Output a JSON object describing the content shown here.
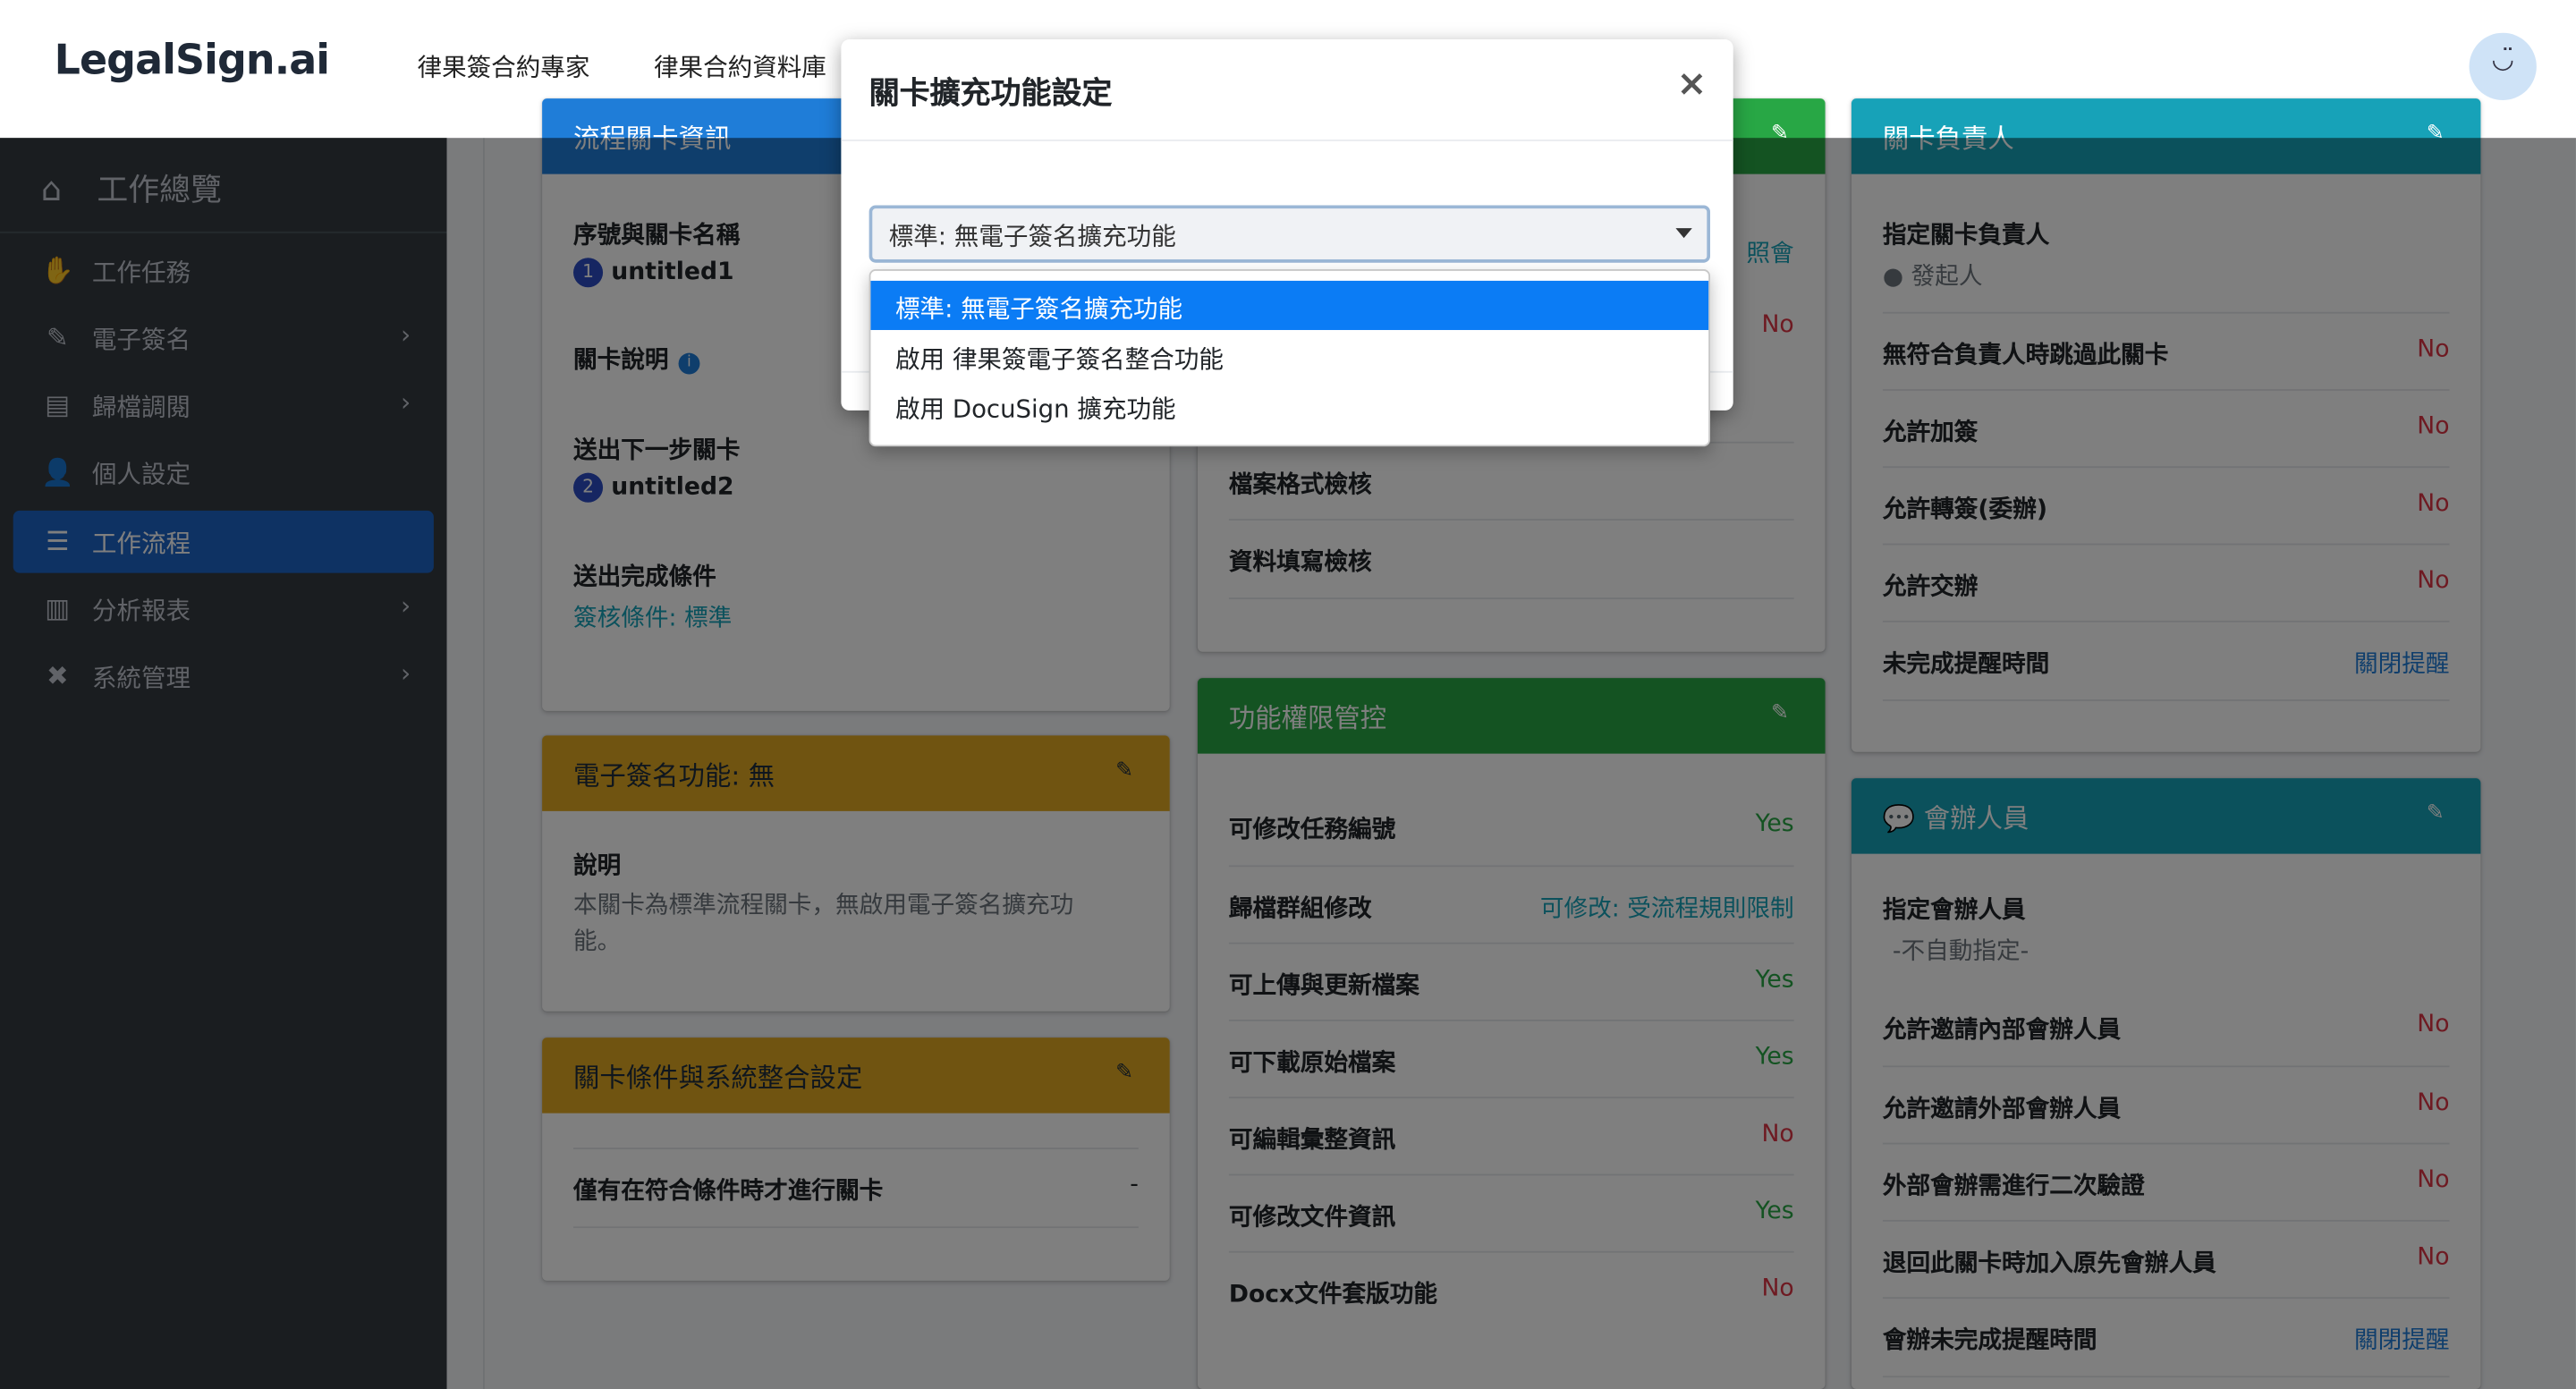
{
  "brand": "LegalSign.ai",
  "topnav": [
    "律果簽合約專家",
    "律果合約資料庫"
  ],
  "sidebar": {
    "dashboard": "工作總覽",
    "items": [
      {
        "label": "工作任務",
        "icon": "handshake-icon",
        "chevron": false
      },
      {
        "label": "電子簽名",
        "icon": "signature-icon",
        "chevron": true
      },
      {
        "label": "歸檔調閱",
        "icon": "archive-icon",
        "chevron": true
      },
      {
        "label": "個人設定",
        "icon": "user-cog-icon",
        "chevron": false
      },
      {
        "label": "工作流程",
        "icon": "tasks-icon",
        "chevron": false,
        "active": true
      },
      {
        "label": "分析報表",
        "icon": "chart-icon",
        "chevron": true
      },
      {
        "label": "系統管理",
        "icon": "tools-icon",
        "chevron": true
      }
    ]
  },
  "card_stage_info": {
    "title": "流程關卡資訊",
    "seq_label": "序號與關卡名稱",
    "seq_num": "1",
    "seq_name": "untitled1",
    "desc_label": "關卡說明",
    "next_label": "送出下一步關卡",
    "next_num": "2",
    "next_name": "untitled2",
    "cond_label": "送出完成條件",
    "cond_value": "簽核條件: 標準"
  },
  "card_esign": {
    "title": "電子簽名功能: 無",
    "desc_label": "說明",
    "desc_text": "本關卡為標準流程關卡，無啟用電子簽名擴充功能。"
  },
  "card_conditions": {
    "title": "關卡條件與系統整合設定",
    "row_label": "僅有在符合條件時才進行關卡",
    "row_value": "-"
  },
  "card_middle_top": {
    "partial_value": "照會",
    "partial_no": "No",
    "rows": [
      "檔案格式檢核",
      "資料填寫檢核"
    ]
  },
  "card_permissions": {
    "title": "功能權限管控",
    "rows": [
      {
        "label": "可修改任務編號",
        "value": "Yes",
        "kind": "yes"
      },
      {
        "label": "歸檔群組修改",
        "value": "可修改: 受流程規則限制",
        "kind": "link"
      },
      {
        "label": "可上傳與更新檔案",
        "value": "Yes",
        "kind": "yes"
      },
      {
        "label": "可下載原始檔案",
        "value": "Yes",
        "kind": "yes"
      },
      {
        "label": "可編輯彙整資訊",
        "value": "No",
        "kind": "no"
      },
      {
        "label": "可修改文件資訊",
        "value": "Yes",
        "kind": "yes"
      },
      {
        "label": "Docx文件套版功能",
        "value": "No",
        "kind": "no"
      }
    ]
  },
  "card_owner": {
    "title": "關卡負責人",
    "assign_label": "指定關卡負責人",
    "assign_value": "發起人",
    "rows": [
      {
        "label": "無符合負責人時跳過此關卡",
        "value": "No",
        "kind": "no"
      },
      {
        "label": "允許加簽",
        "value": "No",
        "kind": "no"
      },
      {
        "label": "允許轉簽(委辦)",
        "value": "No",
        "kind": "no"
      },
      {
        "label": "允許交辦",
        "value": "No",
        "kind": "no"
      },
      {
        "label": "未完成提醒時間",
        "value": "關閉提醒",
        "kind": "link"
      }
    ]
  },
  "card_cosign": {
    "title": "會辦人員",
    "assign_label": "指定會辦人員",
    "assign_value": "-不自動指定-",
    "rows": [
      {
        "label": "允許邀請內部會辦人員",
        "value": "No",
        "kind": "no"
      },
      {
        "label": "允許邀請外部會辦人員",
        "value": "No",
        "kind": "no"
      },
      {
        "label": "外部會辦需進行二次驗證",
        "value": "No",
        "kind": "no"
      },
      {
        "label": "退回此關卡時加入原先會辦人員",
        "value": "No",
        "kind": "no"
      },
      {
        "label": "會辦未完成提醒時間",
        "value": "關閉提醒",
        "kind": "link"
      }
    ]
  },
  "modal": {
    "title": "關卡擴充功能設定",
    "close": "×",
    "selected": "標準: 無電子簽名擴充功能",
    "options": [
      "標準: 無電子簽名擴充功能",
      "啟用 律果簽電子簽名整合功能",
      "啟用 DocuSign 擴充功能"
    ]
  }
}
